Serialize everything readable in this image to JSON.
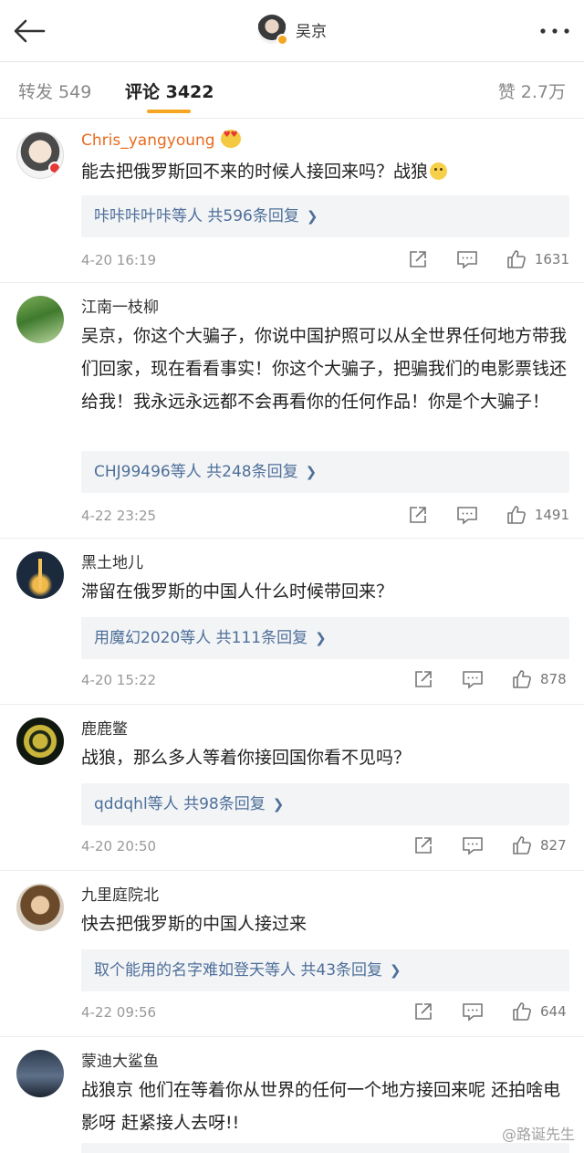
{
  "header": {
    "title": "吴京"
  },
  "tabs": {
    "forward": "转发 549",
    "comment": "评论 3422",
    "like": "赞 2.7万"
  },
  "comments": [
    {
      "name": "Chris_yangyoung",
      "content": "能去把俄罗斯回不来的时候人接回来吗？战狼",
      "replies": "咔咔咔叶咔等人  共596条回复",
      "time": "4-20 16:19",
      "likes": "1631"
    },
    {
      "name": "江南一枝柳",
      "content": "吴京，你这个大骗子，你说中国护照可以从全世界任何地方带我们回家，现在看看事实！你这个大骗子，把骗我们的电影票钱还给我！我永远永远都不会再看你的任何作品！你是个大骗子！",
      "replies": "CHJ99496等人  共248条回复",
      "time": "4-22 23:25",
      "likes": "1491"
    },
    {
      "name": "黑土地儿",
      "content": "滞留在俄罗斯的中国人什么时候带回来？",
      "replies": "用魔幻2020等人  共111条回复",
      "time": "4-20 15:22",
      "likes": "878"
    },
    {
      "name": "鹿鹿鳖",
      "content": "战狼，那么多人等着你接回国你看不见吗？",
      "replies": "qddqhl等人  共98条回复",
      "time": "4-20 20:50",
      "likes": "827"
    },
    {
      "name": "九里庭院北",
      "content": "快去把俄罗斯的中国人接过来",
      "replies": "取个能用的名字难如登天等人  共43条回复",
      "time": "4-22 09:56",
      "likes": "644"
    },
    {
      "name": "蒙迪大鲨鱼",
      "content": "战狼京 他们在等着你从世界的任何一个地方接回来呢 还拍啥电影呀 赶紧接人去呀!!",
      "replies": "",
      "time": "",
      "likes": ""
    }
  ],
  "watermark": "@路诞先生",
  "colors": {
    "accent": "#f5a623",
    "link": "#4e6f9a",
    "vip_name": "#e86b1f"
  }
}
